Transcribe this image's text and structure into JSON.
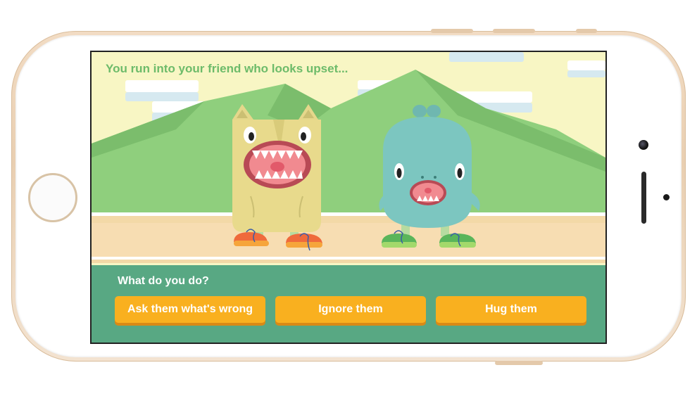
{
  "scene": {
    "prompt": "You run into your friend who looks upset..."
  },
  "panel": {
    "question": "What do you do?",
    "choices": [
      {
        "label": "Ask them what's wrong"
      },
      {
        "label": "Ignore them"
      },
      {
        "label": "Hug them"
      }
    ]
  },
  "colors": {
    "sky": "#f8f6c4",
    "mountain": "#8fcf7d",
    "panel": "#58a883",
    "button": "#f9b01f",
    "prompt_text": "#6dbb6a"
  },
  "characters": [
    {
      "icon": "yellow-cat-monster-icon"
    },
    {
      "icon": "blue-upset-monster-icon"
    }
  ]
}
